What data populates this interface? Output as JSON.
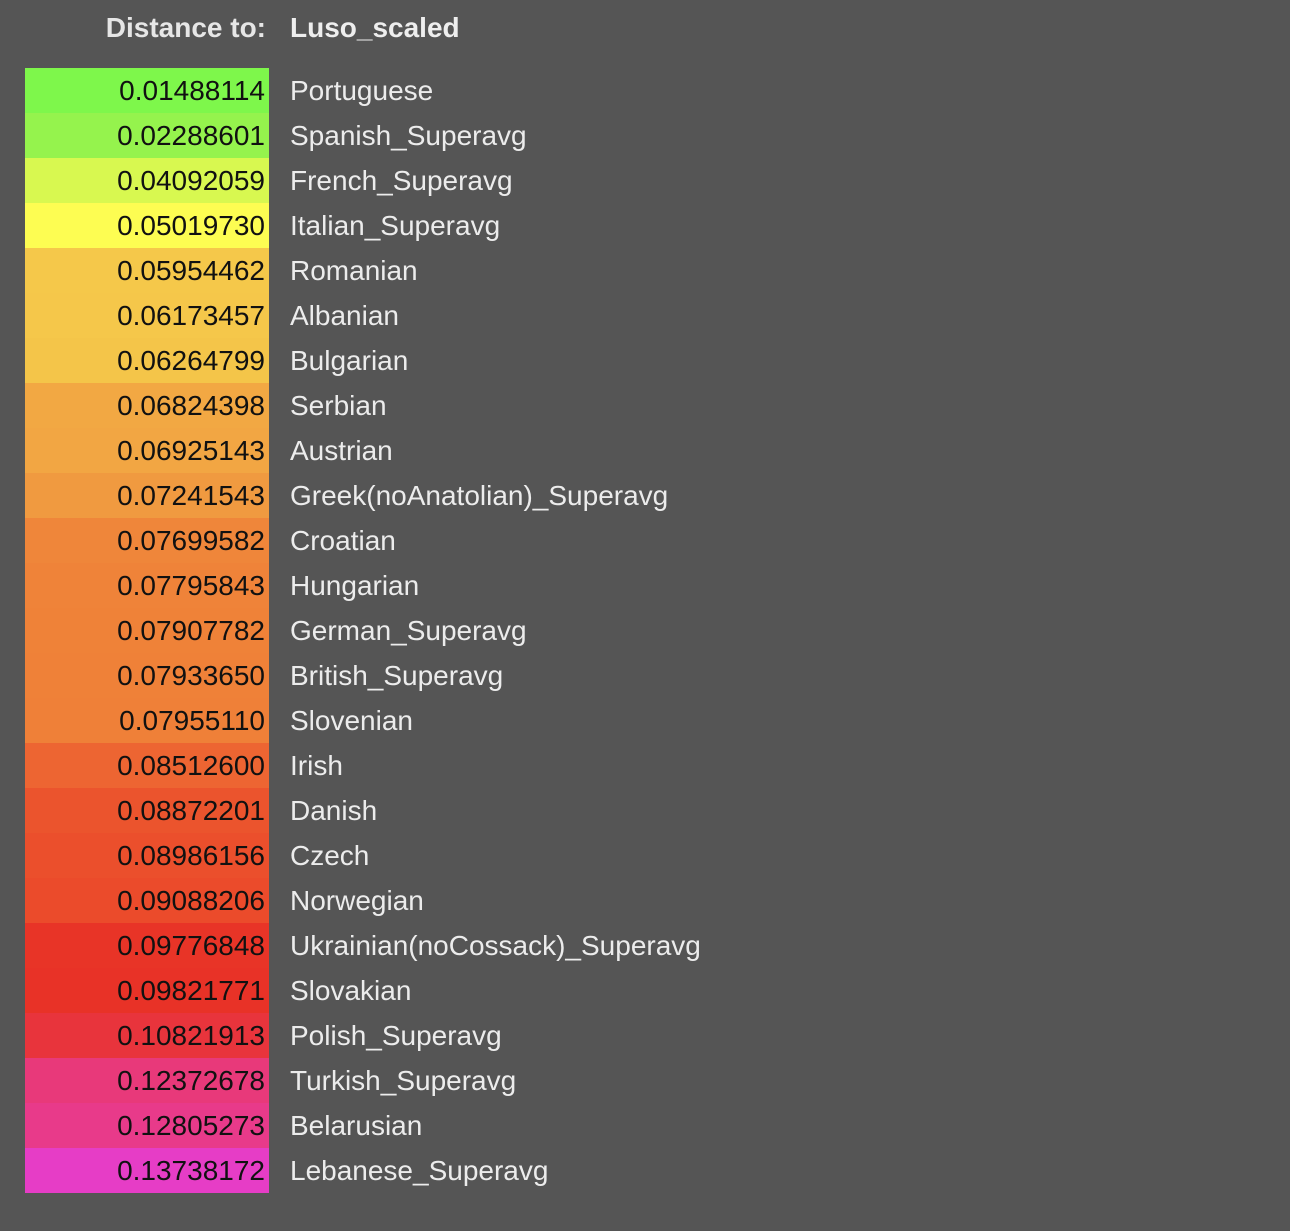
{
  "header": {
    "label": "Distance to:",
    "target": "Luso_scaled"
  },
  "chart_data": {
    "type": "table",
    "title": "",
    "columns": [
      "Distance to:",
      "Luso_scaled"
    ],
    "rows": [
      {
        "value": "0.01488114",
        "name": "Portuguese",
        "color": "#7ef74b"
      },
      {
        "value": "0.02288601",
        "name": "Spanish_Superavg",
        "color": "#95f34d"
      },
      {
        "value": "0.04092059",
        "name": "French_Superavg",
        "color": "#d8f850"
      },
      {
        "value": "0.05019730",
        "name": "Italian_Superavg",
        "color": "#fdfd52"
      },
      {
        "value": "0.05954462",
        "name": "Romanian",
        "color": "#f5c84a"
      },
      {
        "value": "0.06173457",
        "name": "Albanian",
        "color": "#f5c74a"
      },
      {
        "value": "0.06264799",
        "name": "Bulgarian",
        "color": "#f4c549"
      },
      {
        "value": "0.06824398",
        "name": "Serbian",
        "color": "#f2a843"
      },
      {
        "value": "0.06925143",
        "name": "Austrian",
        "color": "#f2a643"
      },
      {
        "value": "0.07241543",
        "name": "Greek(noAnatolian)_Superavg",
        "color": "#f09a40"
      },
      {
        "value": "0.07699582",
        "name": "Croatian",
        "color": "#ef863a"
      },
      {
        "value": "0.07795843",
        "name": "Hungarian",
        "color": "#ef8339"
      },
      {
        "value": "0.07907782",
        "name": "German_Superavg",
        "color": "#ef8238"
      },
      {
        "value": "0.07933650",
        "name": "British_Superavg",
        "color": "#ef8138"
      },
      {
        "value": "0.07955110",
        "name": "Slovenian",
        "color": "#ef8038"
      },
      {
        "value": "0.08512600",
        "name": "Irish",
        "color": "#ed6532"
      },
      {
        "value": "0.08872201",
        "name": "Danish",
        "color": "#eb542d"
      },
      {
        "value": "0.08986156",
        "name": "Czech",
        "color": "#eb4f2c"
      },
      {
        "value": "0.09088206",
        "name": "Norwegian",
        "color": "#eb4b2b"
      },
      {
        "value": "0.09776848",
        "name": "Ukrainian(noCossack)_Superavg",
        "color": "#e83427"
      },
      {
        "value": "0.09821771",
        "name": "Slovakian",
        "color": "#e83227"
      },
      {
        "value": "0.10821913",
        "name": "Polish_Superavg",
        "color": "#e8343c"
      },
      {
        "value": "0.12372678",
        "name": "Turkish_Superavg",
        "color": "#e8397a"
      },
      {
        "value": "0.12805273",
        "name": "Belarusian",
        "color": "#e83a8a"
      },
      {
        "value": "0.13738172",
        "name": "Lebanese_Superavg",
        "color": "#e63dc6"
      }
    ]
  }
}
